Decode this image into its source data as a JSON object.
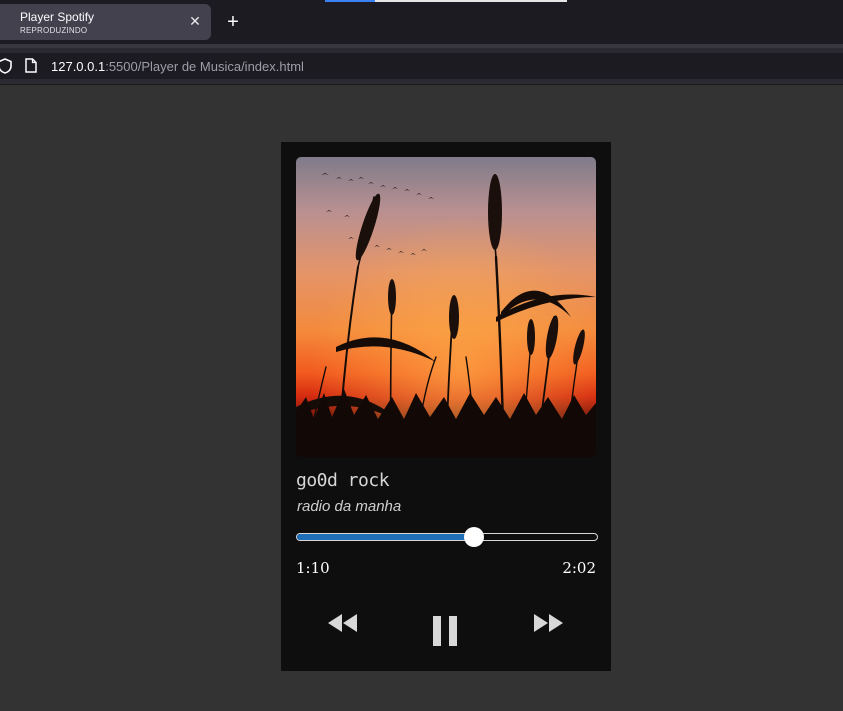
{
  "browser": {
    "tab": {
      "title": "Player Spotify",
      "subtitle": "REPRODUZINDO"
    },
    "url": {
      "host": "127.0.0.1",
      "rest": ":5500/Player de Musica/index.html"
    }
  },
  "player": {
    "title": "go0d rock",
    "artist": "radio da manha",
    "current_time": "1:10",
    "total_time": "2:02",
    "progress_fraction": 0.59,
    "colors": {
      "progress_fill": "#1e6fb8",
      "background": "#0e0e0e",
      "page": "#333333"
    },
    "controls": {
      "rewind_icon": "rewind-icon",
      "pause_icon": "pause-icon",
      "forward_icon": "fast-forward-icon"
    }
  }
}
